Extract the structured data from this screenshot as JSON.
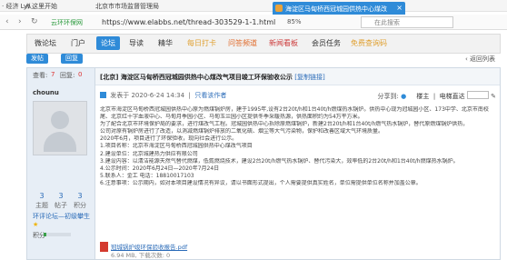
{
  "browser": {
    "favorites": [
      "· 经济 Lyt",
      "从这里开始",
      "北京市市场监督管理局"
    ],
    "tab_title": "海淀区马甸桥西冠城园供热中心煤改",
    "site_logo": "云环环保网",
    "url": "https://www.elabbs.net/thread-303529-1-1.html",
    "zoom": "85%",
    "search_placeholder": "在此搜索"
  },
  "site_nav": {
    "items": [
      "微论坛",
      "门户",
      "论坛",
      "导读",
      "精华",
      "每日打卡",
      "问答频道",
      "新闻看板",
      "会员任务",
      "免费查询码"
    ],
    "active_index": 2
  },
  "toolbar": {
    "publish_label": "发帖",
    "reply_label": "回复",
    "back_label": "返回列表"
  },
  "thread": {
    "views_label": "查看:",
    "views": "7",
    "replies_label": "回复:",
    "replies": "0",
    "tag": "[北京]",
    "title": "海淀区马甸桥西冠城园供热中心煤改气项目竣工环保验收公示",
    "copy_link": "[复制链接]"
  },
  "author": {
    "name": "chounu",
    "stats": [
      {
        "value": "3",
        "label": "主题"
      },
      {
        "value": "3",
        "label": "帖子"
      },
      {
        "value": "3",
        "label": "积分"
      }
    ],
    "group": "环评论坛—初级攀生",
    "stars": "★",
    "points_label": "积分",
    "progress": 0.1
  },
  "post": {
    "posted_at": "发表于 2020-6-24 14:34",
    "view_author": "只看该作者",
    "share_label": "分享到:",
    "share_options": [
      "楼主",
      "电梯直达"
    ],
    "paragraphs": [
      "北京市海淀区马甸桥西冠城园供热中心原为燃煤锅炉房，建于1995年,设有2台20t/h和1台40t/h燃煤热水锅炉。供热中心现为冠城园小区、173中学、北京市南校",
      "尾、北京红十字血液中心、马甸月季园小区、马甸玉兰园小区提供冬季采暖热源，供热面积约为54万平方米。",
      "为了配合北京市环境保护局的要求，进行煤改气工程。冠城园供热中心拆除原燃煤锅炉，新建2台20t/h和1台40t/h燃气热水锅炉，替代原燃煤锅炉供热，",
      "公司对原有锅炉房进行了改造，以消减燃煤锅炉排放的二氧化硫、烟尘等大气污染物，保护和改善区域大气环境质量。",
      "2020年6月，项目进行了环保验收，现向社会进行公示。",
      "1.项目名称：北京市海淀区马甸桥西冠城园供热中心煤改气项目",
      "2.建设单位：北京城建热力供应有限公司",
      "3.建设内容：以清洁能源天然气替代燃煤，低氮燃烧技术，建设2台20t/h燃气热水锅炉、替代污染大，效率低的2台20t/h和1台40t/h燃煤热水锅炉。",
      "4.公示时间：2020年6月24日—2020年7月24日",
      "5.联系人：金工  电话：18810017103",
      "6.注意事项：公示期内，如对本项目建设情况有异议，请以书面形式提出，个人需要提供真实姓名，单位需提供单位名称并加盖公章。"
    ],
    "attachment": {
      "name": "冠城锅炉竣环保验收报告.pdf",
      "meta": "6.94 MB, 下载次数: 0"
    }
  },
  "colors": {
    "accent": "#2f8bd8",
    "link": "#2a6bb8",
    "sidebar_bg": "#e7eef6"
  }
}
